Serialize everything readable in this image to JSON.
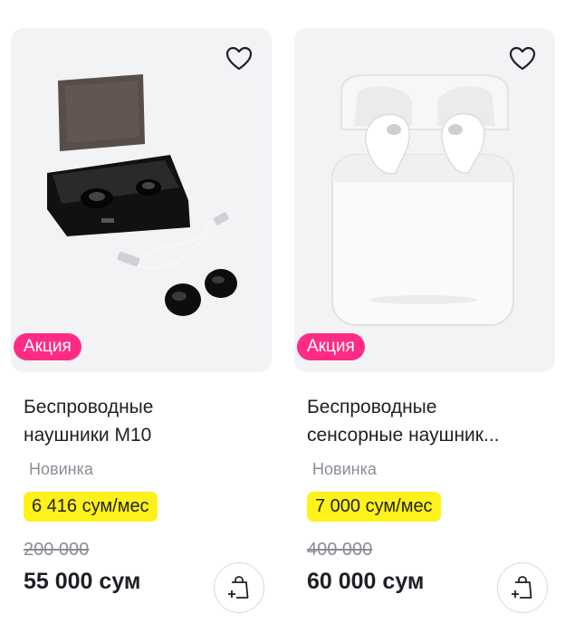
{
  "colors": {
    "promo_badge": "#ff2b84",
    "installment_highlight": "#fff21a",
    "active_dot": "#6b3ce6",
    "card_background": "#f2f3f5"
  },
  "products": [
    {
      "image": "black-earbuds-charging-case",
      "promo_badge": "Акция",
      "title_line1": "Беспроводные",
      "title_line2": "наушники M10",
      "tag": "Новинка",
      "installment": "6 416 сум/мес",
      "old_price": "200 000",
      "price": "55 000 сум",
      "favorite_icon": "heart-outline-icon",
      "cart_icon": "add-to-cart-icon"
    },
    {
      "image": "white-earbuds-case",
      "promo_badge": "Акция",
      "title_line1": "Беспроводные",
      "title_line2": "сенсорные наушник...",
      "tag": "Новинка",
      "installment": "7 000 сум/мес",
      "old_price": "400 000",
      "price": "60 000 сум",
      "favorite_icon": "heart-outline-icon",
      "cart_icon": "add-to-cart-icon"
    }
  ]
}
